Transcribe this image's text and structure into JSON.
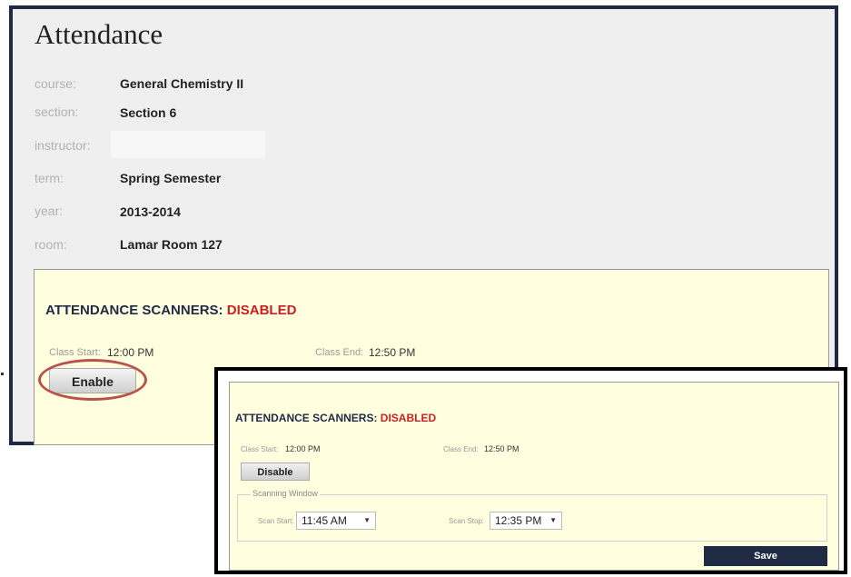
{
  "page": {
    "title": "Attendance"
  },
  "info": {
    "course": {
      "label": "course:",
      "value": "General Chemistry II"
    },
    "section": {
      "label": "section:",
      "value": "Section 6"
    },
    "instructor": {
      "label": "instructor:",
      "value": ""
    },
    "term": {
      "label": "term:",
      "value": "Spring Semester"
    },
    "year": {
      "label": "year:",
      "value": "2013-2014"
    },
    "room": {
      "label": "room:",
      "value": "Lamar Room 127"
    }
  },
  "scanner_main": {
    "title": "ATTENDANCE SCANNERS:",
    "status": "DISABLED",
    "class_start_label": "Class Start:",
    "class_start": "12:00 PM",
    "class_end_label": "Class End:",
    "class_end": "12:50 PM",
    "button_label": "Enable"
  },
  "scanner_inset": {
    "title": "ATTENDANCE SCANNERS:",
    "status": "DISABLED",
    "class_start_label": "Class Start:",
    "class_start": "12:00 PM",
    "class_end_label": "Class End:",
    "class_end": "12:50 PM",
    "button_label": "Disable",
    "window_legend": "Scanning Window",
    "scan_start_label": "Scan Start:",
    "scan_start": "11:45 AM",
    "scan_stop_label": "Scan Stop:",
    "scan_stop": "12:35 PM",
    "save_label": "Save"
  },
  "colors": {
    "navy": "#1f2a44",
    "status_red": "#cc1f1f",
    "panel_yellow": "#ffffe0",
    "highlight": "#b9524d"
  }
}
